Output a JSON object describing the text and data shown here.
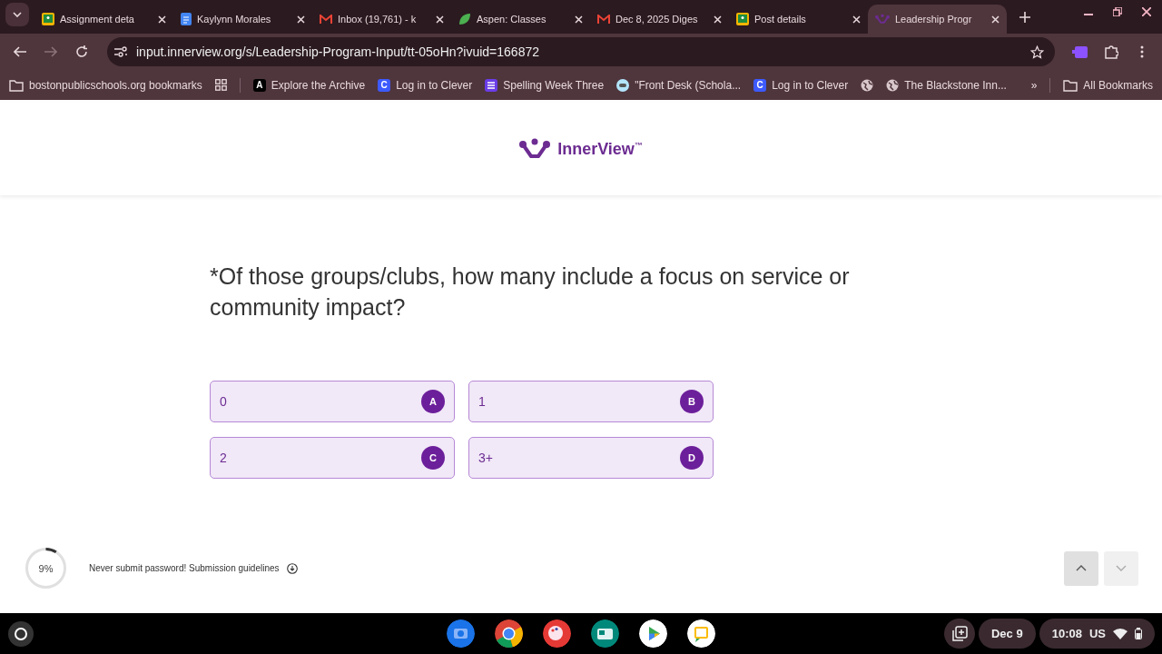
{
  "tabs": [
    {
      "title": "Assignment deta",
      "kind": "classroom",
      "selected": false
    },
    {
      "title": "Kaylynn Morales",
      "kind": "docs",
      "selected": false
    },
    {
      "title": "Inbox (19,761) - k",
      "kind": "mail",
      "selected": false
    },
    {
      "title": "Aspen: Classes",
      "kind": "leaf",
      "selected": false
    },
    {
      "title": "Dec 8, 2025 Diges",
      "kind": "mail",
      "selected": false
    },
    {
      "title": "Post details",
      "kind": "classroom",
      "selected": false
    },
    {
      "title": "Leadership Progr",
      "kind": "innerview",
      "selected": true
    }
  ],
  "address_bar": {
    "url": "input.innerview.org/s/Leadership-Program-Input/tt-05oHn?ivuid=166872"
  },
  "bookmarks": [
    {
      "label": "bostonpublicschools.org bookmarks",
      "kind": "folder"
    },
    {
      "label": "Explore the Archive",
      "kind": "archive",
      "glyph": "A"
    },
    {
      "label": "Log in to Clever",
      "kind": "clever",
      "glyph": "C"
    },
    {
      "label": "Spelling Week Three",
      "kind": "list"
    },
    {
      "label": "\"Front Desk (Schola...",
      "kind": "robot"
    },
    {
      "label": "Log in to Clever",
      "kind": "clever",
      "glyph": "C"
    },
    {
      "kind": "globe"
    },
    {
      "label": "The Blackstone Inn...",
      "kind": "globe"
    }
  ],
  "all_bookmarks": "All Bookmarks",
  "more_bookmarks": "»",
  "logo": {
    "name": "InnerView",
    "mark": "™"
  },
  "question": "*Of those groups/clubs, how many include a focus on service or community impact?",
  "options": [
    {
      "label": "0",
      "key": "A"
    },
    {
      "label": "1",
      "key": "B"
    },
    {
      "label": "2",
      "key": "C"
    },
    {
      "label": "3+",
      "key": "D"
    }
  ],
  "progress": {
    "level": 0.09,
    "reading": "9%"
  },
  "footer_note": "Never submit password! Submission guidelines",
  "nav": [
    {
      "kind": "up",
      "disabled": false
    },
    {
      "kind": "down",
      "disabled": true
    }
  ],
  "shelf": {
    "date": "Dec 9",
    "time": "10:08",
    "locale": "US"
  }
}
